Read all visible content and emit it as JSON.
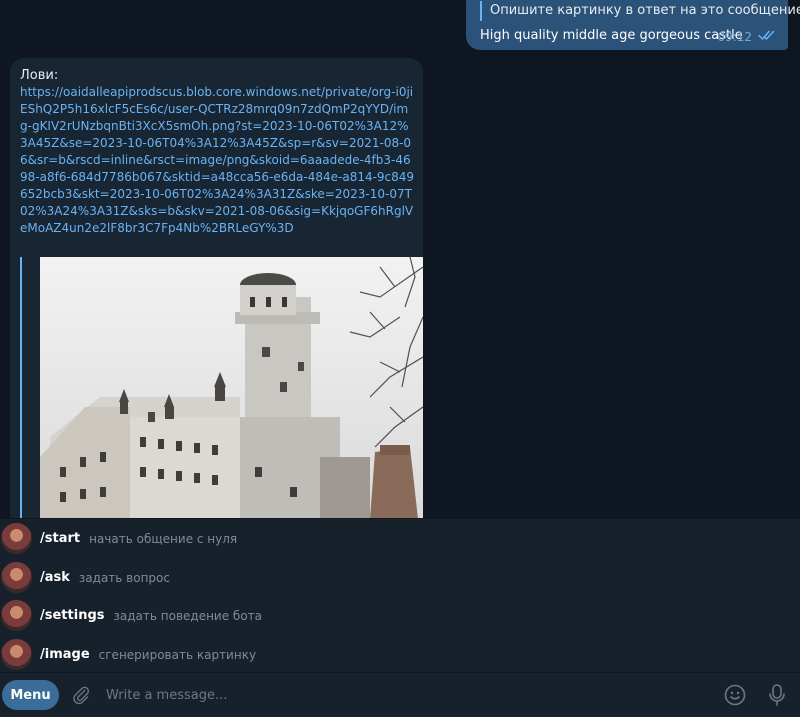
{
  "outgoing": {
    "reply_quote": "Опишите картинку в ответ на это сообщение",
    "text": "High quality middle age gorgeous castle",
    "time": "09:12",
    "status": "read"
  },
  "incoming": {
    "title": "Лови:",
    "link": "https://oaidalleapiprodscus.blob.core.windows.net/private/org-i0jiEShQ2P5h16xlcF5cEs6c/user-QCTRz28mrq09n7zdQmP2qYYD/img-gKIV2rUNzbqnBti3XcX5smOh.png?st=2023-10-06T02%3A12%3A45Z&se=2023-10-06T04%3A12%3A45Z&sp=r&sv=2021-08-06&sr=b&rscd=inline&rsct=image/png&skoid=6aaadede-4fb3-4698-a8f6-684d7786b067&sktid=a48cca56-e6da-484e-a814-9c849652bcb3&skt=2023-10-06T02%3A24%3A31Z&ske=2023-10-07T02%3A24%3A31Z&sks=b&skv=2021-08-06&sig=KkjqoGF6hRglVeMoAZ4un2e2lF8br3C7Fp4Nb%2BRLeGY%3D",
    "preview_image": "castle-photo"
  },
  "commands": [
    {
      "name": "/start",
      "description": "начать общение с нуля"
    },
    {
      "name": "/ask",
      "description": "задать вопрос"
    },
    {
      "name": "/settings",
      "description": "задать поведение бота"
    },
    {
      "name": "/image",
      "description": "сгенерировать картинку"
    }
  ],
  "input": {
    "menu_label": "Menu",
    "placeholder": "Write a message...",
    "value": ""
  },
  "colors": {
    "background": "#0e1621",
    "outgoing_bubble": "#2b5278",
    "incoming_bubble": "#182533",
    "link": "#6ab3f3",
    "panel": "#17212b",
    "menu_button": "#3a6d99"
  },
  "icons": [
    "double-check-icon",
    "bot-avatar",
    "attach-icon",
    "emoji-icon",
    "microphone-icon"
  ]
}
